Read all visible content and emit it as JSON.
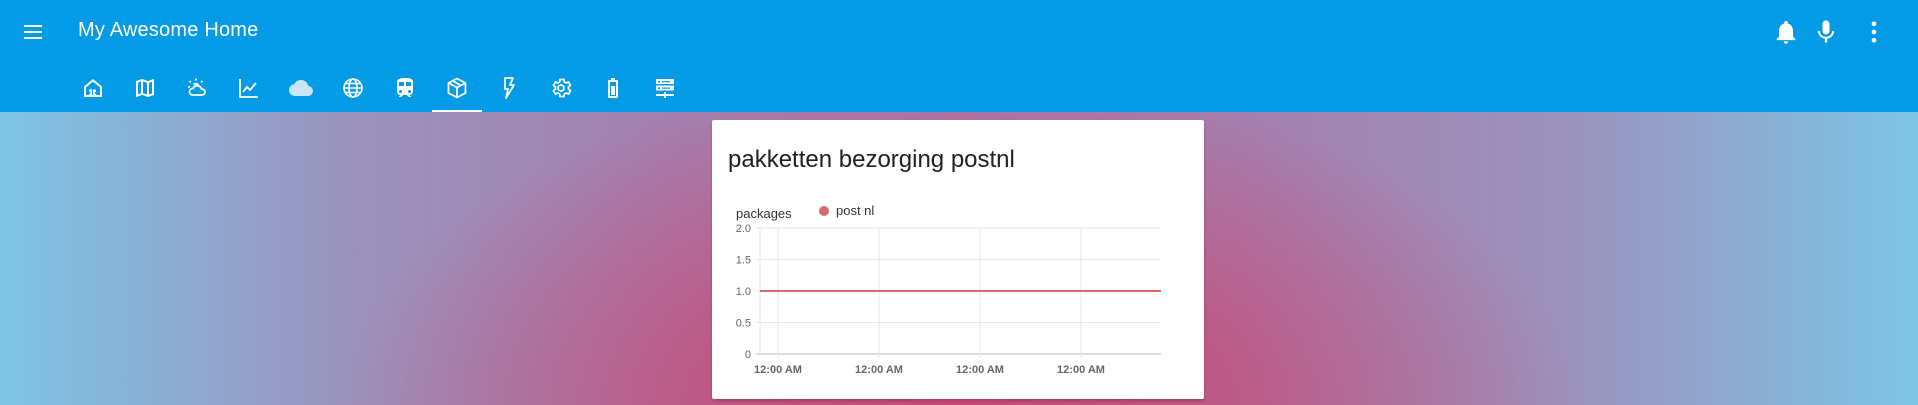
{
  "app": {
    "title": "My Awesome Home",
    "accent_color": "#039be5"
  },
  "toolbar": {
    "menu_icon": "hamburger-menu-icon",
    "actions": [
      {
        "name": "notifications",
        "icon": "bell-icon"
      },
      {
        "name": "voice",
        "icon": "microphone-icon"
      },
      {
        "name": "more",
        "icon": "dots-vertical-icon"
      }
    ]
  },
  "tabs": {
    "active_index": 7,
    "items": [
      {
        "icon": "home-assistant-icon"
      },
      {
        "icon": "map-icon"
      },
      {
        "icon": "weather-partly-cloudy-icon"
      },
      {
        "icon": "chart-line-icon"
      },
      {
        "icon": "cloud-icon"
      },
      {
        "icon": "globe-icon"
      },
      {
        "icon": "train-icon"
      },
      {
        "icon": "package-icon"
      },
      {
        "icon": "flash-icon"
      },
      {
        "icon": "settings-icon"
      },
      {
        "icon": "battery-icon"
      },
      {
        "icon": "server-icon"
      }
    ]
  },
  "card": {
    "title": "pakketten bezorging postnl"
  },
  "chart_data": {
    "type": "line",
    "ylabel": "packages",
    "ylim": [
      0,
      2.0
    ],
    "y_ticks": [
      "0",
      "0.5",
      "1.0",
      "1.5",
      "2.0"
    ],
    "x_ticks": [
      "12:00 AM",
      "12:00 AM",
      "12:00 AM",
      "12:00 AM"
    ],
    "legend": "top",
    "grid": true,
    "series": [
      {
        "name": "post nl",
        "color": "#d46a6a",
        "values": [
          1.0,
          1.0,
          1.0,
          1.0,
          1.0
        ]
      }
    ]
  }
}
